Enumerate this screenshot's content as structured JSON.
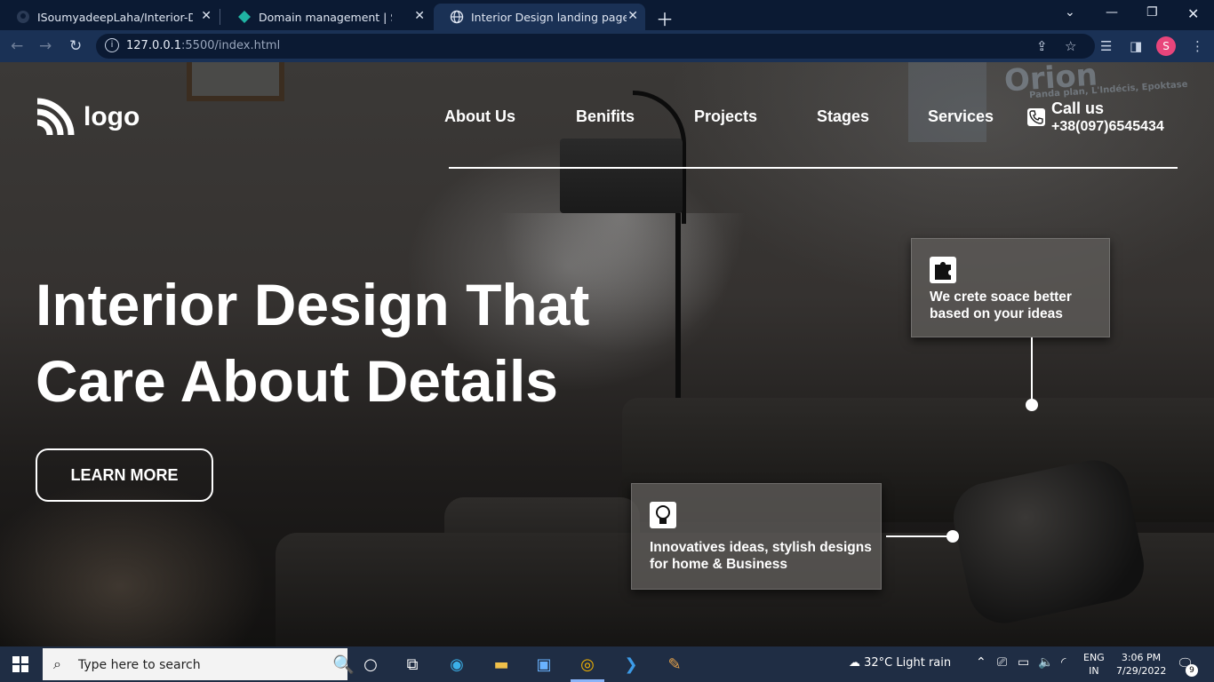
{
  "browser": {
    "tabs": [
      {
        "title": "ISoumyadeepLaha/Interior-Desig",
        "icon": "github-icon"
      },
      {
        "title": "Domain management | Site settir",
        "icon": "netlify-icon"
      },
      {
        "title": "Interior Design landing page",
        "icon": "globe-icon",
        "active": true
      }
    ],
    "url_host": "127.0.0.1",
    "url_rest": ":5500/index.html",
    "profile_initial": "S"
  },
  "page": {
    "logo_text": "logo",
    "nav": [
      "About Us",
      "Benifits",
      "Projects",
      "Stages",
      "Services"
    ],
    "call_label": "Call us",
    "call_number": "+38(097)6545434",
    "hero_line1": "Interior Design That",
    "hero_line2": "Care About Details",
    "cta_label": "LEARN MORE",
    "card1_text": "We crete soace better based on your ideas",
    "card2_text": "Innovatives ideas, stylish designs for home & Business",
    "background_sign": "Orion",
    "background_sign_sub": "Panda plan, L'Indécis, Epoktase"
  },
  "taskbar": {
    "search_placeholder": "Type here to search",
    "weather": "32°C  Light rain",
    "lang_line1": "ENG",
    "lang_line2": "IN",
    "time": "3:06 PM",
    "date": "7/29/2022",
    "notification_count": "9"
  },
  "colors": {
    "tabbar": "#0b1a33",
    "toolbar": "#1a3155",
    "taskbar": "#1f2d44",
    "profile": "#e8457b"
  }
}
